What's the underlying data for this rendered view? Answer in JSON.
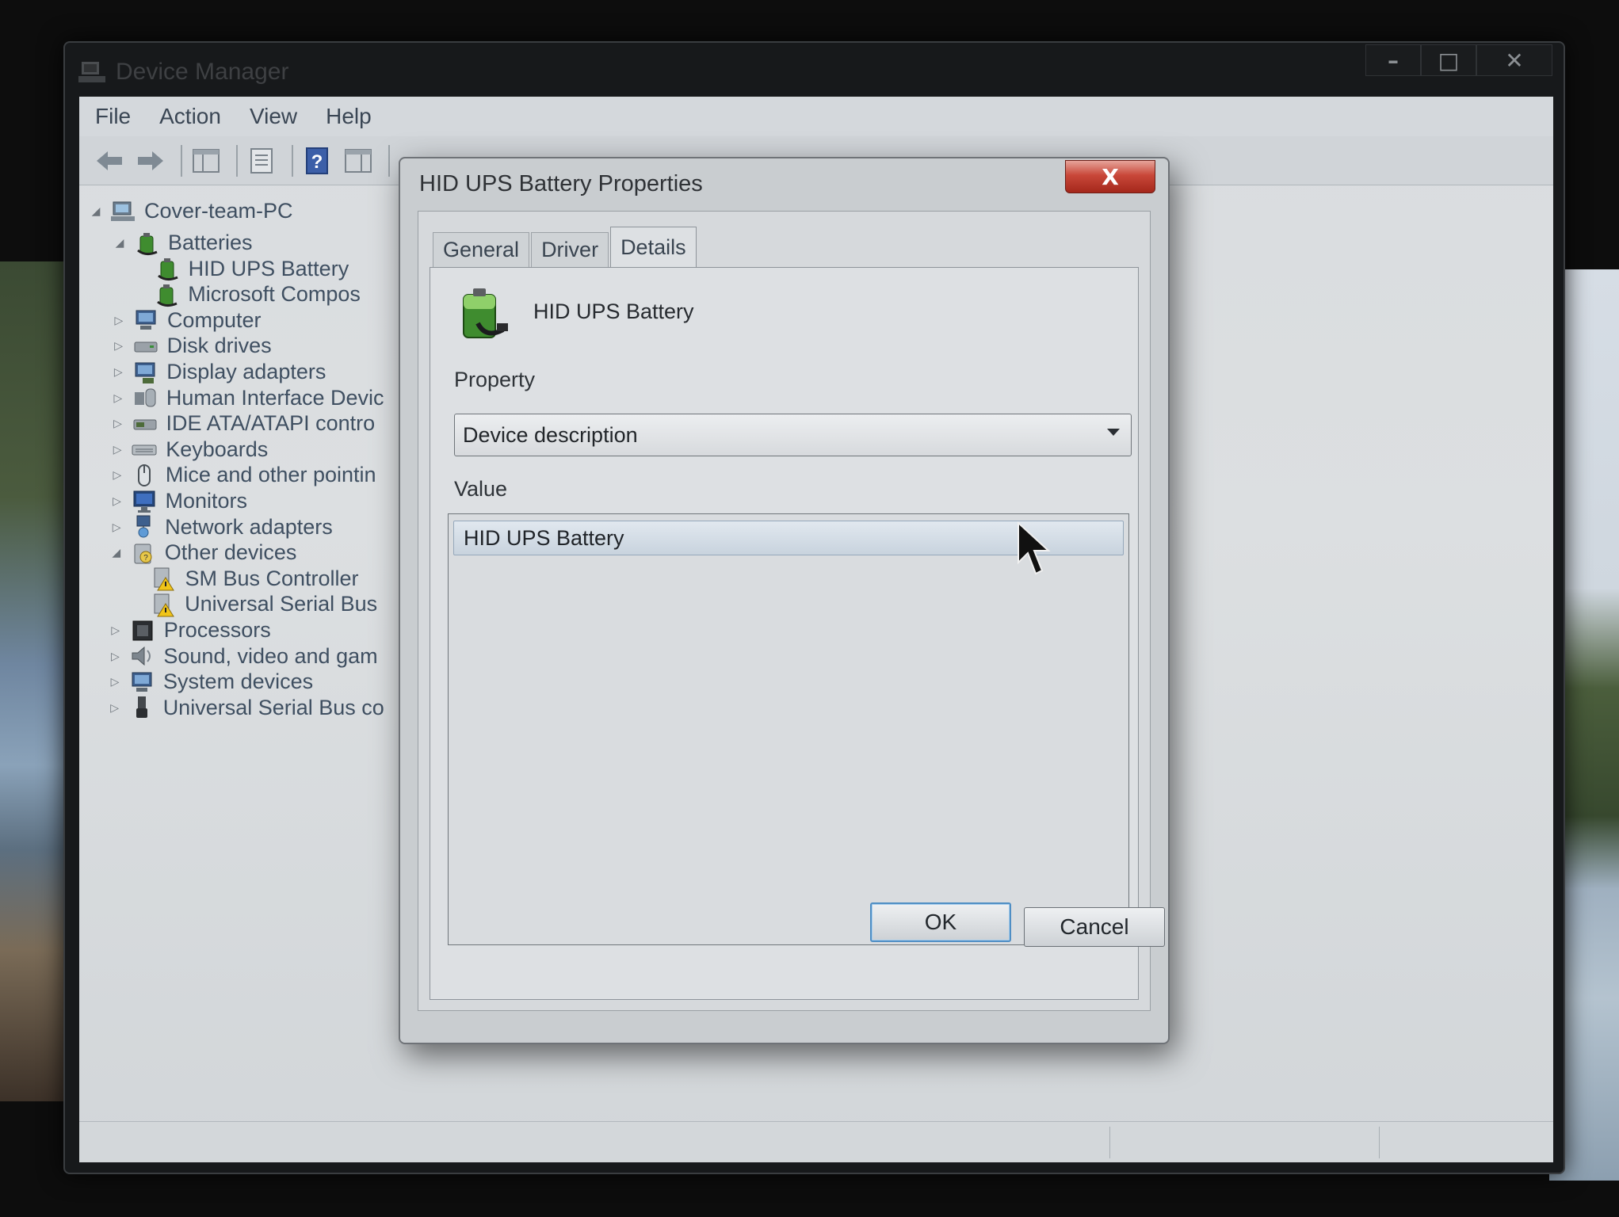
{
  "device_manager": {
    "title": "Device Manager",
    "window_buttons": [
      "–",
      "□",
      "✕"
    ],
    "menu": [
      "File",
      "Action",
      "View",
      "Help"
    ],
    "tree": {
      "root": "Cover-team-PC",
      "items": [
        {
          "label": "Batteries",
          "icon": "battery-icon",
          "expanded": true
        },
        {
          "label": "HID UPS Battery",
          "icon": "battery-icon",
          "child": true
        },
        {
          "label": "Microsoft Compos",
          "icon": "battery-icon",
          "child": true
        },
        {
          "label": "Computer",
          "icon": "computer-icon"
        },
        {
          "label": "Disk drives",
          "icon": "disk-drive-icon"
        },
        {
          "label": "Display adapters",
          "icon": "display-adapter-icon"
        },
        {
          "label": "Human Interface Devic",
          "icon": "hid-icon"
        },
        {
          "label": "IDE ATA/ATAPI contro",
          "icon": "ide-controller-icon"
        },
        {
          "label": "Keyboards",
          "icon": "keyboard-icon"
        },
        {
          "label": "Mice and other pointin",
          "icon": "mouse-icon"
        },
        {
          "label": "Monitors",
          "icon": "monitor-icon"
        },
        {
          "label": "Network adapters",
          "icon": "network-adapter-icon"
        },
        {
          "label": "Other devices",
          "icon": "other-devices-icon",
          "expanded": true
        },
        {
          "label": "SM Bus Controller",
          "icon": "warning-device-icon",
          "child": true
        },
        {
          "label": "Universal Serial Bus",
          "icon": "warning-device-icon",
          "child": true
        },
        {
          "label": "Processors",
          "icon": "processor-icon"
        },
        {
          "label": "Sound, video and gam",
          "icon": "sound-icon"
        },
        {
          "label": "System devices",
          "icon": "system-devices-icon"
        },
        {
          "label": "Universal Serial Bus co",
          "icon": "usb-icon"
        }
      ]
    }
  },
  "dialog": {
    "title": "HID UPS Battery Properties",
    "close": "X",
    "tabs": [
      "General",
      "Driver",
      "Details"
    ],
    "active_tab": "Details",
    "device_name": "HID UPS Battery",
    "property_label": "Property",
    "property_value": "Device description",
    "value_label": "Value",
    "values": [
      "HID UPS Battery"
    ],
    "ok": "OK",
    "cancel": "Cancel"
  },
  "colors": {
    "close_button": "#c9483a",
    "selection": "#c8d3de",
    "default_button_border": "#4f8ec4"
  }
}
